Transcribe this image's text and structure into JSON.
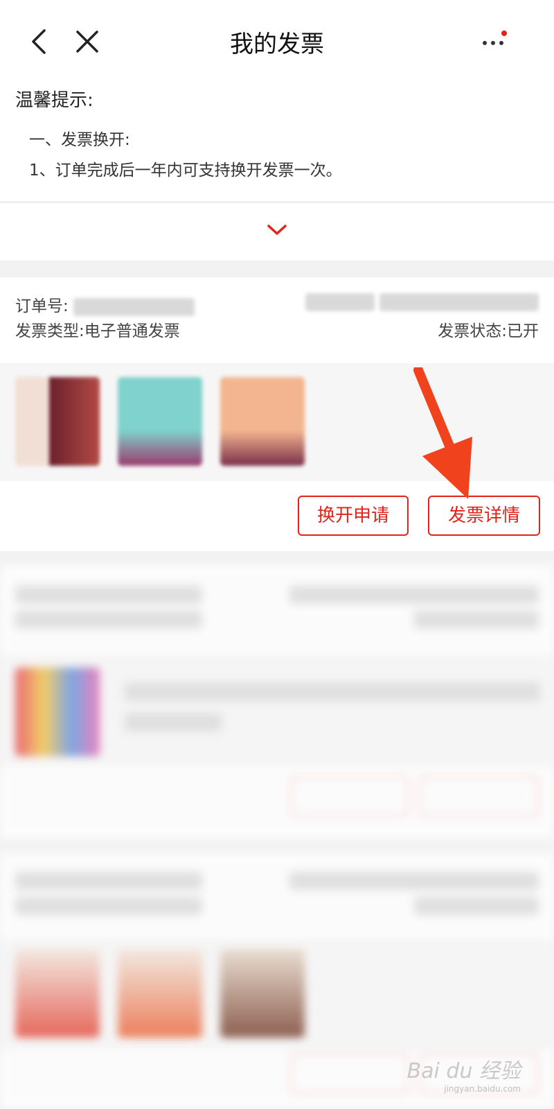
{
  "header": {
    "title": "我的发票",
    "back_icon": "back-arrow-icon",
    "close_icon": "close-icon",
    "more_icon": "more-dots-icon",
    "badge_color": "#e2231a"
  },
  "tips": {
    "title": "温馨提示:",
    "section": "一、发票换开:",
    "line1": "1、订单完成后一年内可支持换开发票一次。"
  },
  "expand": {
    "icon": "chevron-down-icon",
    "color": "#e2231a"
  },
  "orders": [
    {
      "order_label": "订单号:",
      "invoice_type_label": "发票类型:",
      "invoice_type": "电子普通发票",
      "status_label": "发票状态:",
      "status": "已开",
      "exchange_label": "换开申请",
      "detail_label": "发票详情"
    }
  ],
  "watermark": {
    "text": "Bai du 经验",
    "sub": "jingyan.baidu.com"
  },
  "accent": "#e2231a"
}
